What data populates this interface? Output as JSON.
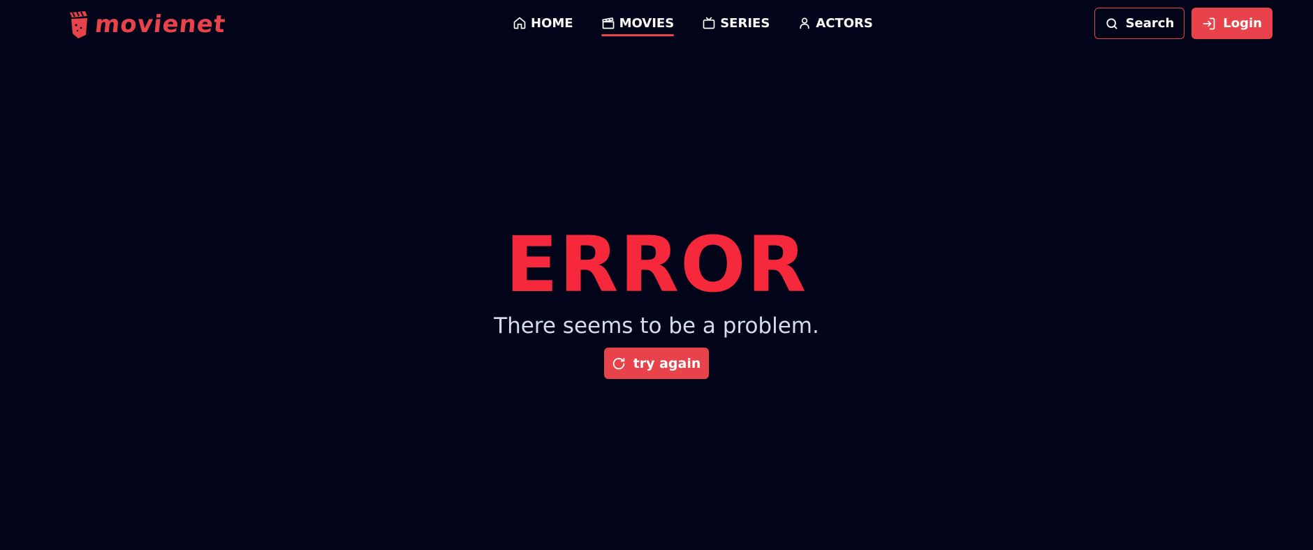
{
  "brand": {
    "name": "movienet",
    "accent_color": "#e8434b",
    "logo_icon": "clapperboard-logo-icon"
  },
  "nav": {
    "items": [
      {
        "label": "HOME",
        "icon": "home-icon",
        "active": false
      },
      {
        "label": "MOVIES",
        "icon": "clapperboard-icon",
        "active": true
      },
      {
        "label": "SERIES",
        "icon": "tv-icon",
        "active": false
      },
      {
        "label": "ACTORS",
        "icon": "user-icon",
        "active": false
      }
    ]
  },
  "header_actions": {
    "search_label": "Search",
    "search_icon": "search-icon",
    "login_label": "Login",
    "login_icon": "login-icon"
  },
  "error": {
    "title": "ERROR",
    "title_color": "#f5283c",
    "message": "There seems to be a problem.",
    "retry_label": "try again",
    "retry_icon": "refresh-icon"
  },
  "colors": {
    "background": "#02051a",
    "text": "#ffffff",
    "muted_text": "#d4dcf0"
  }
}
